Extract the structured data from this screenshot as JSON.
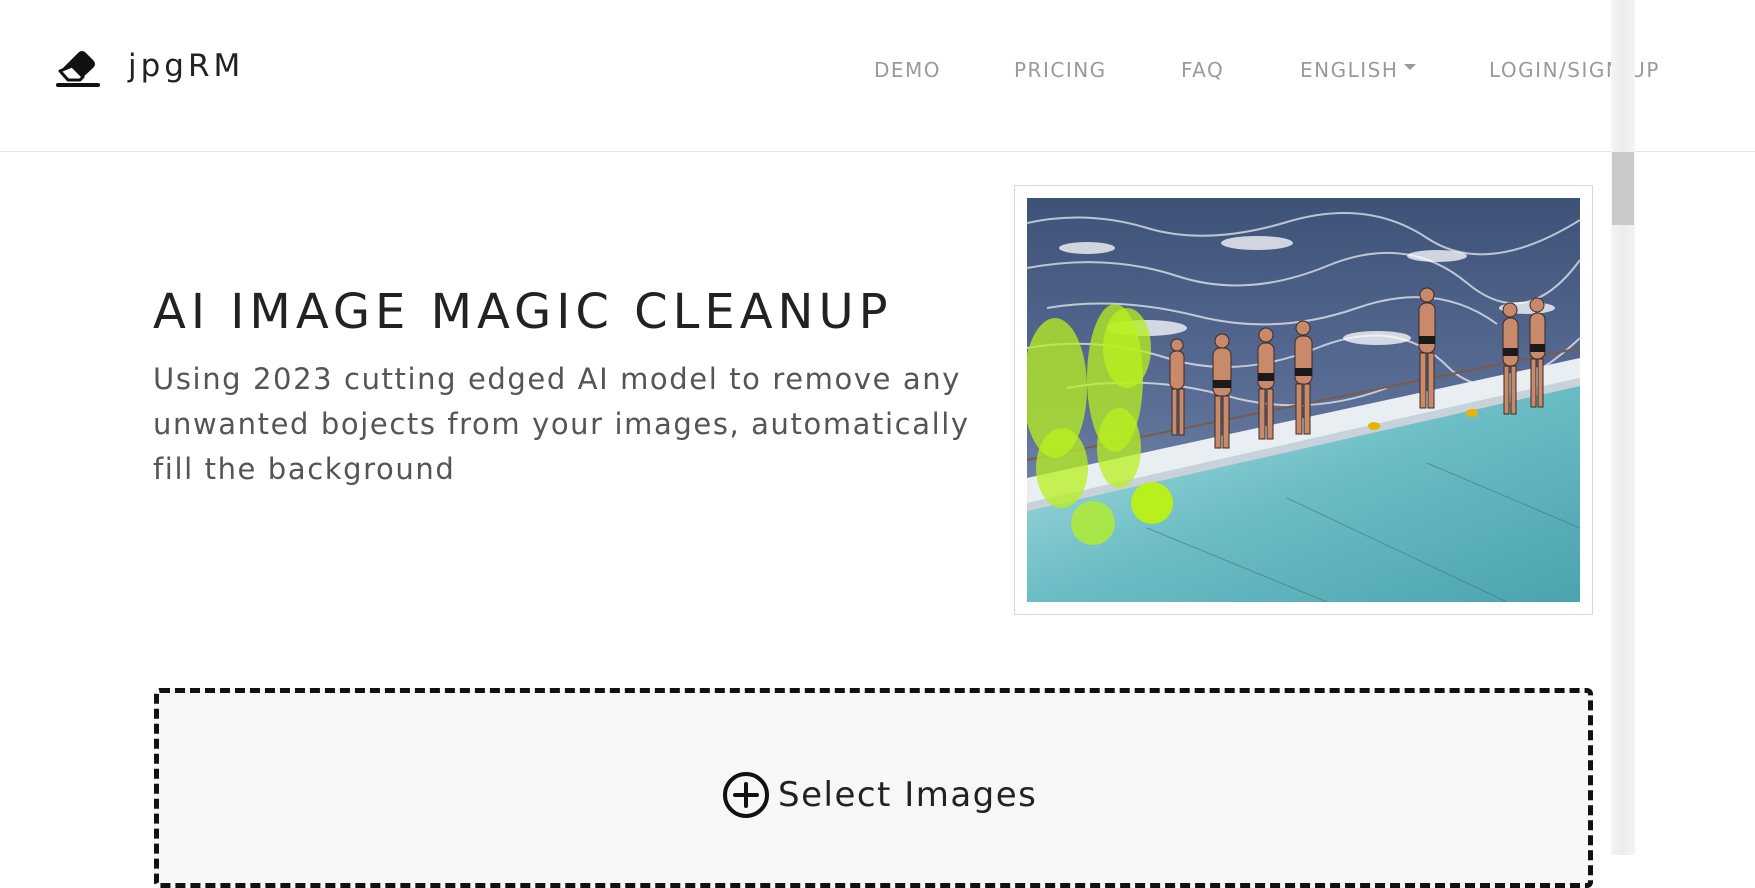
{
  "navbar": {
    "brand_icon": "eraser-icon",
    "brand_name": "jpgRM",
    "links": {
      "demo": "DEMO",
      "pricing": "PRICING",
      "faq": "FAQ",
      "language": "ENGLISH",
      "login": "LOGIN/SIGN UP"
    },
    "language_dropdown_icon": "caret-down-icon"
  },
  "hero": {
    "title": "AI IMAGE MAGIC CLEANUP",
    "description": "Using 2023 cutting edged AI model to remove any unwanted bojects from your images, automatically fill the background"
  },
  "demo_image": {
    "content": "swimmers on the edge of an ocean pool, with some people highlighted by a green brush mask",
    "mask_color": "#b8f01e"
  },
  "upload": {
    "icon": "plus-circle-icon",
    "label": "Select Images"
  },
  "colors": {
    "text_primary": "#222222",
    "text_secondary": "#555555",
    "nav_text": "#9a9a9a",
    "dropzone_bg": "#f7f7f7",
    "dropzone_border": "#111111"
  }
}
